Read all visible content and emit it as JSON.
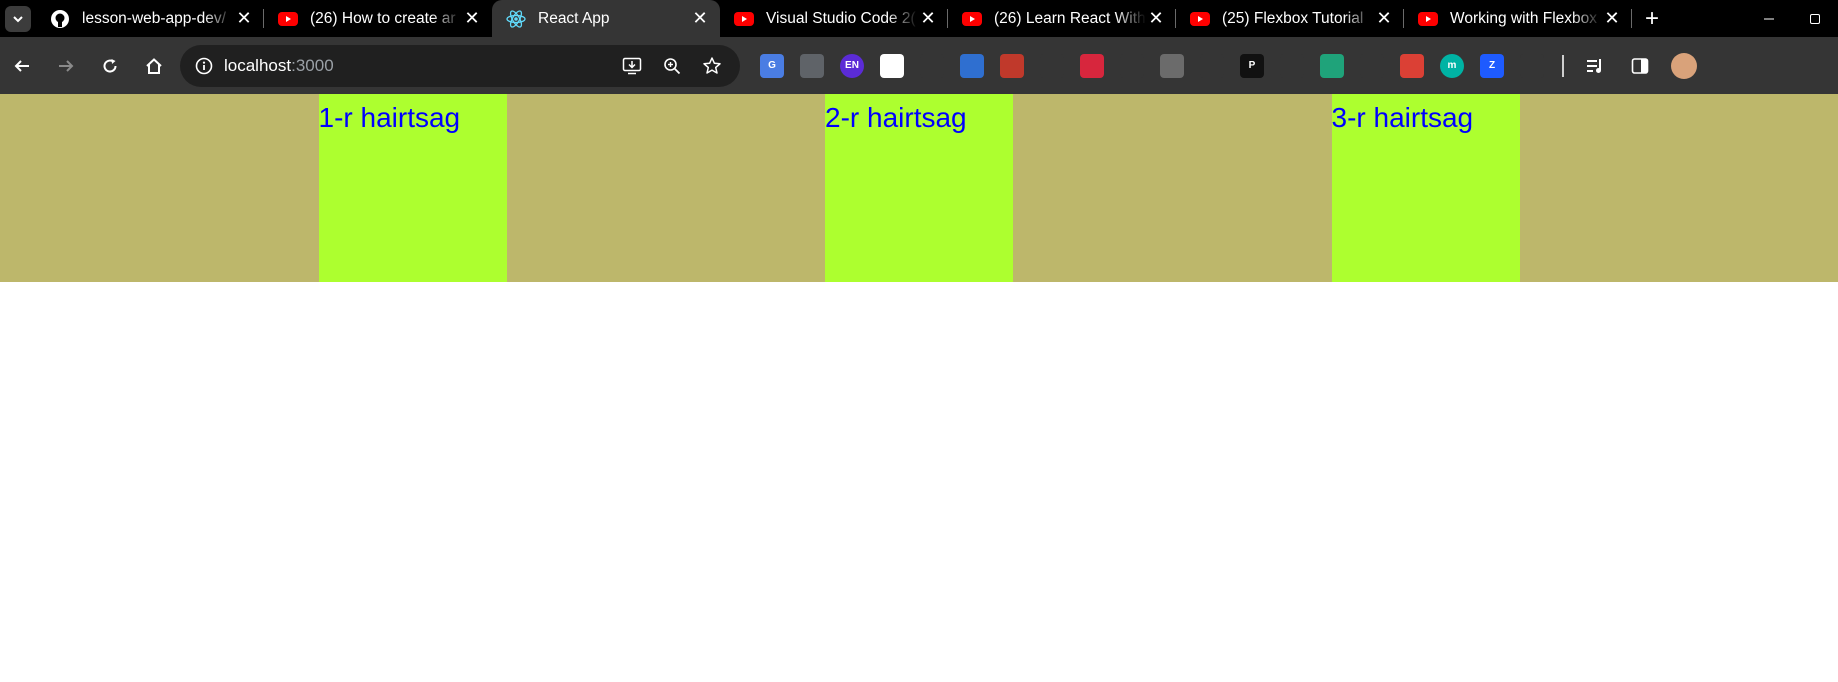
{
  "tabs": [
    {
      "title": "lesson-web-app-dev/",
      "favicon": "github-icon",
      "active": false
    },
    {
      "title": "(26) How to create ar",
      "favicon": "youtube-icon",
      "active": false
    },
    {
      "title": "React App",
      "favicon": "react-icon",
      "active": true
    },
    {
      "title": "Visual Studio Code 2(",
      "favicon": "youtube-icon",
      "active": false
    },
    {
      "title": "(26) Learn React With",
      "favicon": "youtube-icon",
      "active": false
    },
    {
      "title": "(25) Flexbox Tutorial",
      "favicon": "youtube-icon",
      "active": false
    },
    {
      "title": "Working with Flexbox",
      "favicon": "youtube-icon",
      "active": false
    }
  ],
  "new_tab_label": "+",
  "address_bar": {
    "host": "localhost",
    "port": ":3000"
  },
  "extensions": [
    {
      "name": "google-translate-icon",
      "color": "#4a7de3",
      "glyph": "G"
    },
    {
      "name": "document-icon",
      "color": "#5f6368",
      "glyph": ""
    },
    {
      "name": "en-extension-icon",
      "color": "#5b2bd6",
      "glyph": "EN"
    },
    {
      "name": "white-shape-icon",
      "color": "#ffffff",
      "glyph": ""
    },
    {
      "name": "bird-icon",
      "color": "#353535",
      "glyph": ""
    },
    {
      "name": "stack-icon",
      "color": "#2f6fd0",
      "glyph": ""
    },
    {
      "name": "red-book-icon",
      "color": "#c0392b",
      "glyph": ""
    },
    {
      "name": "download-arrow-icon",
      "color": "#353535",
      "glyph": ""
    },
    {
      "name": "mendeley-icon",
      "color": "#d7263d",
      "glyph": ""
    },
    {
      "name": "blue-gem-icon",
      "color": "#353535",
      "glyph": ""
    },
    {
      "name": "grey-bookmark-icon",
      "color": "#6b6b6b",
      "glyph": ""
    },
    {
      "name": "green-arrow-icon",
      "color": "#353535",
      "glyph": ""
    },
    {
      "name": "p-extension-icon",
      "color": "#111111",
      "glyph": "P"
    },
    {
      "name": "mouse-icon",
      "color": "#353535",
      "glyph": ""
    },
    {
      "name": "teal-download-icon",
      "color": "#1fa37a",
      "glyph": ""
    },
    {
      "name": "blue-arrow-down-icon",
      "color": "#353535",
      "glyph": ""
    },
    {
      "name": "todoist-icon",
      "color": "#db4035",
      "glyph": ""
    },
    {
      "name": "m-extension-icon",
      "color": "#00b3a4",
      "glyph": "m"
    },
    {
      "name": "z-extension-icon",
      "color": "#1e5bff",
      "glyph": "Z"
    },
    {
      "name": "owl-icon",
      "color": "#353535",
      "glyph": ""
    }
  ],
  "page": {
    "background": "#bdb76b",
    "box_color": "#adff2f",
    "text_color": "#0000ff",
    "items": [
      {
        "label": "1-r hairtsag"
      },
      {
        "label": "2-r hairtsag"
      },
      {
        "label": "3-r hairtsag"
      }
    ]
  }
}
